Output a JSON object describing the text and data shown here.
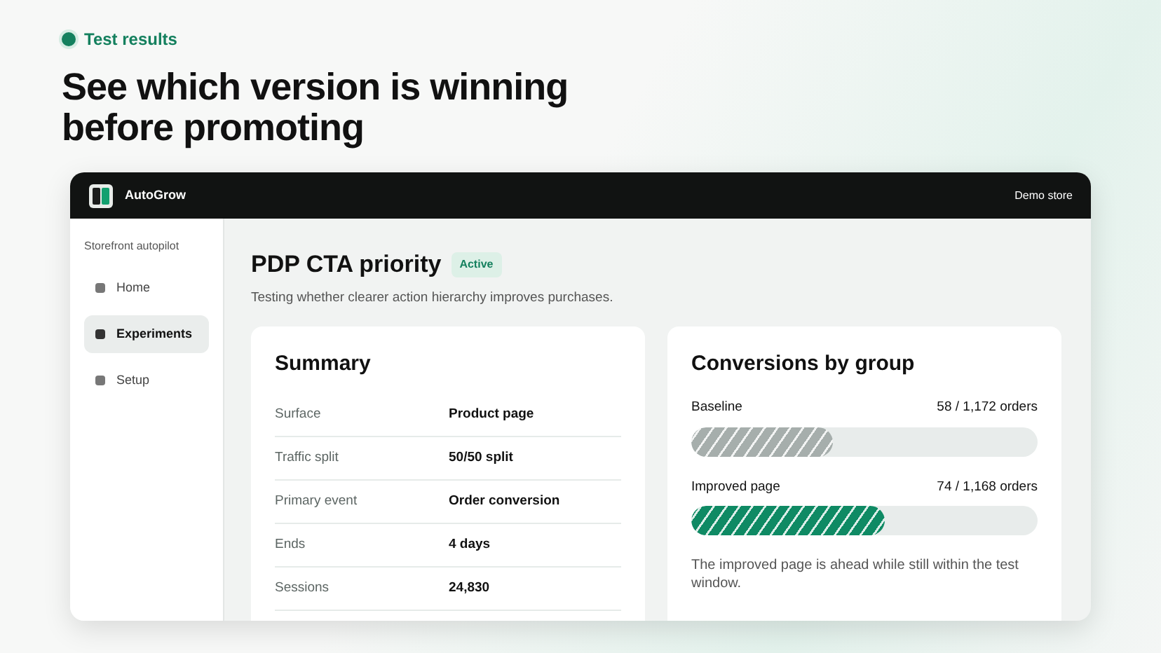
{
  "eyebrow": "Test results",
  "headline": "See which version is winning before promoting",
  "window": {
    "app_name": "AutoGrow",
    "store": "Demo store"
  },
  "sidebar": {
    "section": "Storefront autopilot",
    "items": [
      {
        "label": "Home",
        "selected": false
      },
      {
        "label": "Experiments",
        "selected": true
      },
      {
        "label": "Setup",
        "selected": false
      }
    ]
  },
  "experiment": {
    "title": "PDP CTA priority",
    "status": "Active",
    "description": "Testing whether clearer action hierarchy improves purchases."
  },
  "summary": {
    "title": "Summary",
    "rows": [
      {
        "label": "Surface",
        "value": "Product page"
      },
      {
        "label": "Traffic split",
        "value": "50/50 split"
      },
      {
        "label": "Primary event",
        "value": "Order conversion"
      },
      {
        "label": "Ends",
        "value": "4 days"
      },
      {
        "label": "Sessions",
        "value": "24,830"
      }
    ]
  },
  "conversions": {
    "title": "Conversions by group",
    "groups": [
      {
        "name": "Baseline",
        "reading": "58 / 1,172 orders",
        "level": 0.41,
        "color": "#a6aeac"
      },
      {
        "name": "Improved page",
        "reading": "74 / 1,168 orders",
        "level": 0.56,
        "color": "#0f8a64"
      }
    ],
    "note": "The improved page is ahead while still within the test window."
  }
}
